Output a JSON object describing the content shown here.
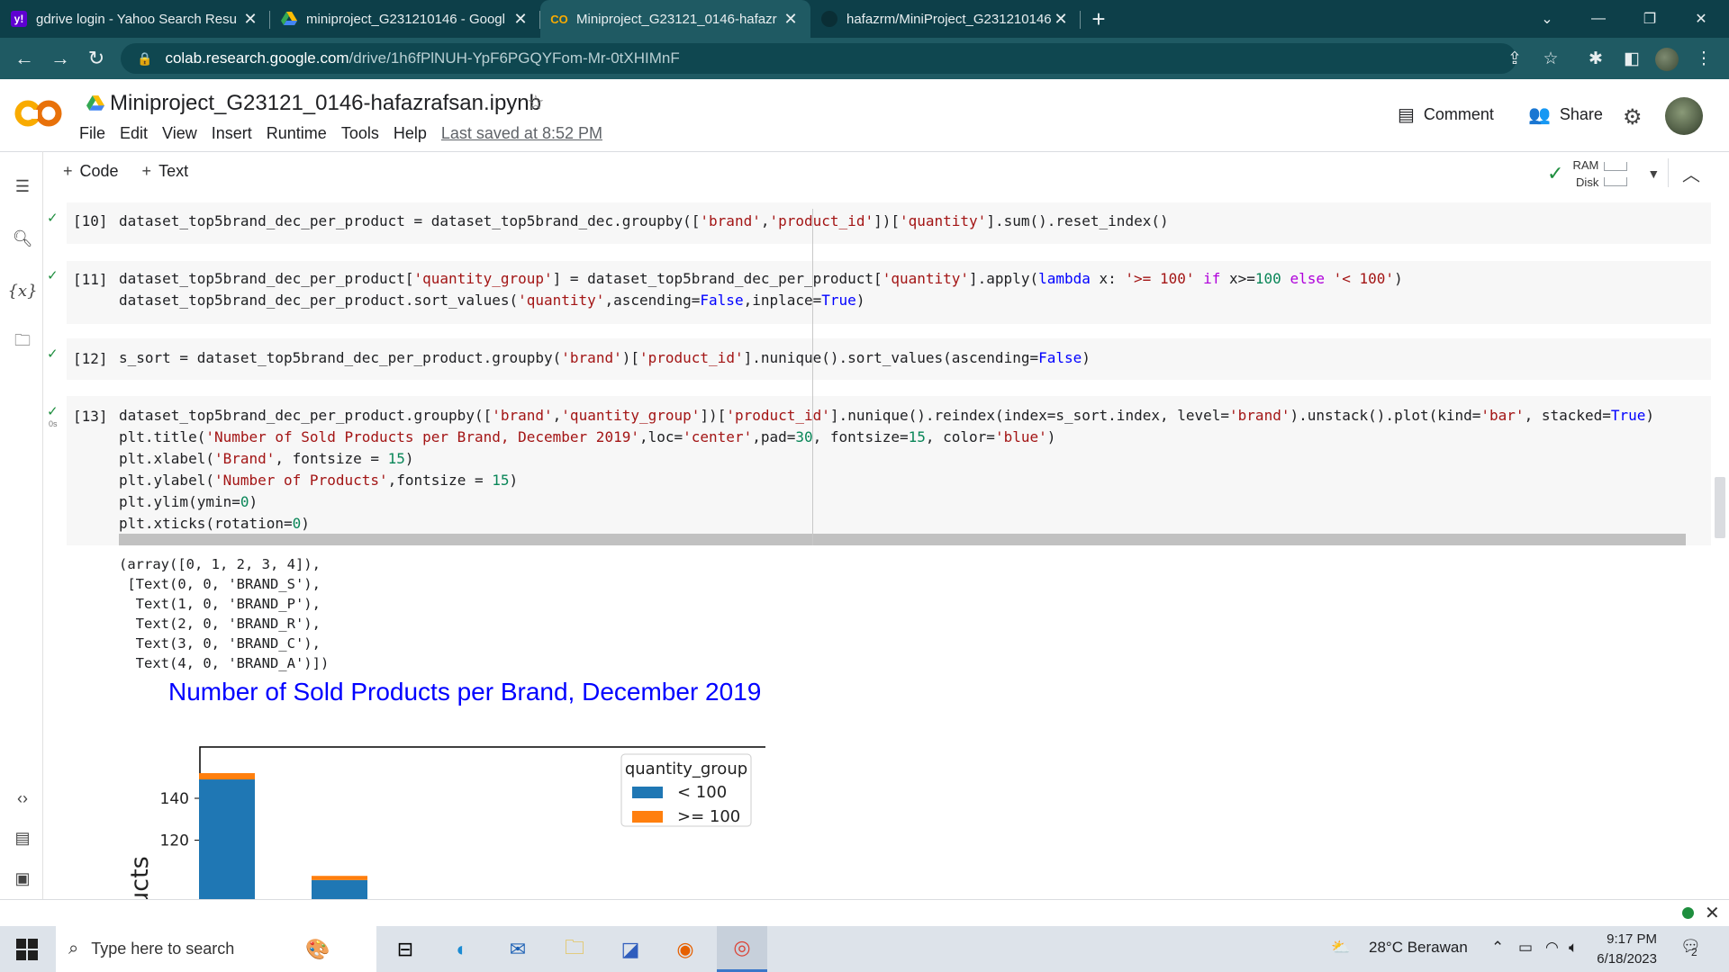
{
  "browser": {
    "tabs": [
      {
        "title": "gdrive login - Yahoo Search Resu",
        "favicon": "yahoo-icon",
        "active": false
      },
      {
        "title": "miniproject_G231210146 - Googl",
        "favicon": "google-drive-icon",
        "active": false
      },
      {
        "title": "Miniproject_G23121_0146-hafazr",
        "favicon": "colab-icon",
        "active": true
      },
      {
        "title": "hafazrm/MiniProject_G231210146",
        "favicon": "github-icon",
        "active": false
      }
    ],
    "url_host": "colab.research.google.com",
    "url_path": "/drive/1h6fPlNUH-YpF6PGQYFom-Mr-0tXHIMnF"
  },
  "colab": {
    "notebook_title": "Miniproject_G23121_0146-hafazrafsan.ipynb",
    "menu": [
      "File",
      "Edit",
      "View",
      "Insert",
      "Runtime",
      "Tools",
      "Help"
    ],
    "last_saved": "Last saved at 8:52 PM",
    "comment_label": "Comment",
    "share_label": "Share",
    "toolbar": {
      "code_label": "Code",
      "text_label": "Text"
    },
    "resources": {
      "ram_label": "RAM",
      "disk_label": "Disk"
    }
  },
  "cells": [
    {
      "exec": "[10]",
      "status": "✓"
    },
    {
      "exec": "[11]",
      "status": "✓"
    },
    {
      "exec": "[12]",
      "status": "✓"
    },
    {
      "exec": "[13]",
      "status": "✓",
      "time": "0s"
    }
  ],
  "output_text": "(array([0, 1, 2, 3, 4]),\n [Text(0, 0, 'BRAND_S'),\n  Text(1, 0, 'BRAND_P'),\n  Text(2, 0, 'BRAND_R'),\n  Text(3, 0, 'BRAND_C'),\n  Text(4, 0, 'BRAND_A')])",
  "chart_data": {
    "type": "bar",
    "title": "Number of Sold Products per Brand, December 2019",
    "ylabel": "ducts",
    "categories": [
      "BRAND_S",
      "BRAND_P"
    ],
    "series": [
      {
        "name": "< 100",
        "color": "#1f77b4",
        "values": [
          149,
          101
        ]
      },
      {
        "name": ">= 100",
        "color": "#ff7f0e",
        "values": [
          3,
          2
        ]
      }
    ],
    "visible_yticks": [
      120,
      140
    ],
    "legend": {
      "title": "quantity_group",
      "placement": "top-right"
    }
  },
  "taskbar": {
    "search_placeholder": "Type here to search",
    "weather": "28°C  Berawan",
    "time": "9:17 PM",
    "date": "6/18/2023",
    "notifications": "2"
  }
}
